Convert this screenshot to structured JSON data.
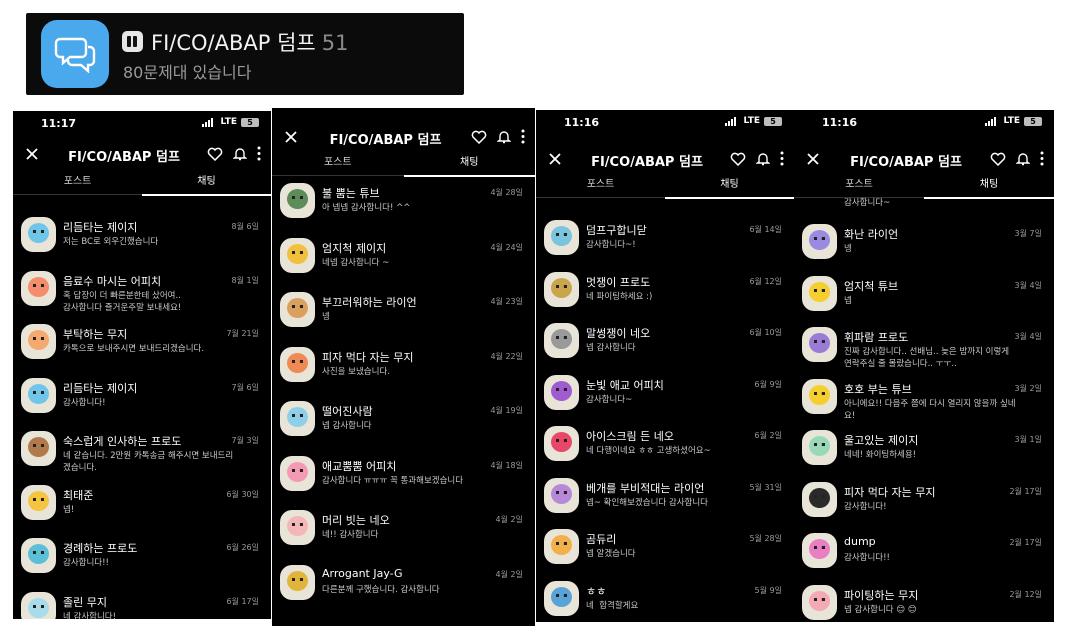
{
  "banner": {
    "title": "FI/CO/ABAP 덤프",
    "count": "51",
    "subtitle": "80문제대 있습니다",
    "app_icon": "chat-bubbles-icon",
    "badge_icon": "pause-badge-icon",
    "icon_color": "#4aa8ec"
  },
  "phones": [
    {
      "status": {
        "time": "11:17",
        "network": "LTE",
        "battery": "5"
      },
      "header": {
        "title": "FI/CO/ABAP 덤프"
      },
      "tabs": [
        {
          "label": "포스트"
        },
        {
          "label": "채팅"
        }
      ],
      "rows": [
        {
          "name": "리듬타는 제이지",
          "message": "저는 BC로 외우긴했습니다",
          "date": "8월 6일",
          "color": "#6fc6e8"
        },
        {
          "name": "음료수 마시는 어피치",
          "message": "혹 답장이 더 빠른분한테 샀어여..\n감사합니다 즐거운주말 보내세요!",
          "date": "8월 1일",
          "color": "#f58c6c"
        },
        {
          "name": "부탁하는 무지",
          "message": "카톡으로 보내주시면 보내드리겠습니다.",
          "date": "7월 21일",
          "color": "#f6a96e"
        },
        {
          "name": "리듬타는 제이지",
          "message": "감사합니다!",
          "date": "7월 6일",
          "color": "#6fc6e8"
        },
        {
          "name": "숙스럽게 인사하는 프로도",
          "message": "네 같습니다. 2만원 카톡송금 해주시면 보내드리\n겠습니다.",
          "date": "7월 3일",
          "color": "#b07a4c"
        },
        {
          "name": "최태준",
          "message": "넵!",
          "date": "6월 30일",
          "color": "#f5c542"
        },
        {
          "name": "경례하는 프로도",
          "message": "감사합니다!!",
          "date": "6월 26일",
          "color": "#5cbfd8"
        },
        {
          "name": "졸린 무지",
          "message": "네 감사합니다!",
          "date": "6월 17일",
          "color": "#a8dcea"
        }
      ]
    },
    {
      "status": {
        "time": "",
        "network": "",
        "battery": ""
      },
      "header": {
        "title": "FI/CO/ABAP 덤프"
      },
      "tabs": [
        {
          "label": "포스트"
        },
        {
          "label": "채팅"
        }
      ],
      "rows": [
        {
          "name": "불 뿜는 튜브",
          "message": "아 넵넵 감사합니다! ^^",
          "date": "4월 28일",
          "color": "#5d8c5a"
        },
        {
          "name": "엄지척 제이지",
          "message": "네넵 감사합니다 ~",
          "date": "4월 24일",
          "color": "#f2c03c"
        },
        {
          "name": "부끄러워하는 라이언",
          "message": "넹",
          "date": "4월 23일",
          "color": "#d9a15d"
        },
        {
          "name": "피자 먹다 자는 무지",
          "message": "사진을 보냈습니다.",
          "date": "4월 22일",
          "color": "#f08a55"
        },
        {
          "name": "떨어진사람",
          "message": "넵 감사합니다",
          "date": "4월 19일",
          "color": "#8fd0e8"
        },
        {
          "name": "애교뿜뿜 어피치",
          "message": "감사합니다 ㅠㅠㅠ 꼭 통과해보겠습니다",
          "date": "4월 18일",
          "color": "#f59ab4"
        },
        {
          "name": "머리 빗는 네오",
          "message": "네!! 감사합니다",
          "date": "4월 2일",
          "color": "#f3b7b7"
        },
        {
          "name": "Arrogant Jay-G",
          "message": "다른분께 구했습니다. 감사합니다",
          "date": "4월 2일",
          "color": "#e1b43a"
        }
      ]
    },
    {
      "status": {
        "time": "11:16",
        "network": "LTE",
        "battery": "5"
      },
      "header": {
        "title": "FI/CO/ABAP 덤프"
      },
      "tabs": [
        {
          "label": "포스트"
        },
        {
          "label": "채팅"
        }
      ],
      "rows": [
        {
          "name": "덤프구합니닫",
          "message": "감사합니다~!",
          "date": "6월 14일",
          "color": "#7ac4de"
        },
        {
          "name": "멋쟁이 프로도",
          "message": "네 파이팅하세요 :)",
          "date": "6월 12일",
          "color": "#c9a64a"
        },
        {
          "name": "말썽쟁이 네오",
          "message": "넵 감사합니다",
          "date": "6월 10일",
          "color": "#9a9a9a"
        },
        {
          "name": "눈빛 애교 어피치",
          "message": "감사합니다~",
          "date": "6월 9일",
          "color": "#a05bd0"
        },
        {
          "name": "아이스크림 든 네오",
          "message": "네 다행이네요 ㅎㅎ 고생하셨어요~",
          "date": "6월 2일",
          "color": "#e8476a"
        },
        {
          "name": "베개를 부비적대는 라이언",
          "message": "넵~ 확인해보겠습니다 감사합니다",
          "date": "5월 31일",
          "color": "#b68ad8"
        },
        {
          "name": "곰듀리",
          "message": "넵 알겠습니다",
          "date": "5월 28일",
          "color": "#f2b04a"
        },
        {
          "name": "ㅎㅎ",
          "message": "네  합격할게요",
          "date": "5월 9일",
          "color": "#5aa3d8"
        }
      ]
    },
    {
      "status": {
        "time": "11:16",
        "network": "LTE",
        "battery": "5"
      },
      "header": {
        "title": "FI/CO/ABAP 덤프"
      },
      "tabs": [
        {
          "label": "포스트"
        },
        {
          "label": "채팅"
        }
      ],
      "rows": [
        {
          "name": "화난 라이언",
          "message": "넹",
          "date": "3월 7일",
          "color": "#9b8be0"
        },
        {
          "name": "엄지척 튜브",
          "message": "넵",
          "date": "3월 4일",
          "color": "#f5cf2e"
        },
        {
          "name": "휘파람 프로도",
          "message": "진짜 감사합니다.. 선배님.. 늦은 밤까지 이렇게\n연락주실 줄 몰랐습니다.. ㅜㅜ..",
          "date": "3월 4일",
          "color": "#9a7cd6"
        },
        {
          "name": "호호 부는 튜브",
          "message": "아니에요!! 다음주 쯤에 다시 열리지 않을까 싶네\n요!",
          "date": "3월 2일",
          "color": "#f5d02c"
        },
        {
          "name": "울고있는 제이지",
          "message": "네네! 화이팅하세용!",
          "date": "3월 1일",
          "color": "#9ad9b8"
        },
        {
          "name": "피자 먹다 자는 무지",
          "message": "감사합니다!",
          "date": "2월 17일",
          "color": "#2a2a2a"
        },
        {
          "name": "dump",
          "message": "감사합니다!!",
          "date": "2월 17일",
          "color": "#e87fc2"
        },
        {
          "name": "파이팅하는 무지",
          "message": "넵 감사합니다 😊 😊",
          "date": "2월 12일",
          "color": "#f4a9b4"
        }
      ]
    }
  ],
  "partials": {
    "p3_top": "",
    "p4_top": "감사합니다~"
  }
}
